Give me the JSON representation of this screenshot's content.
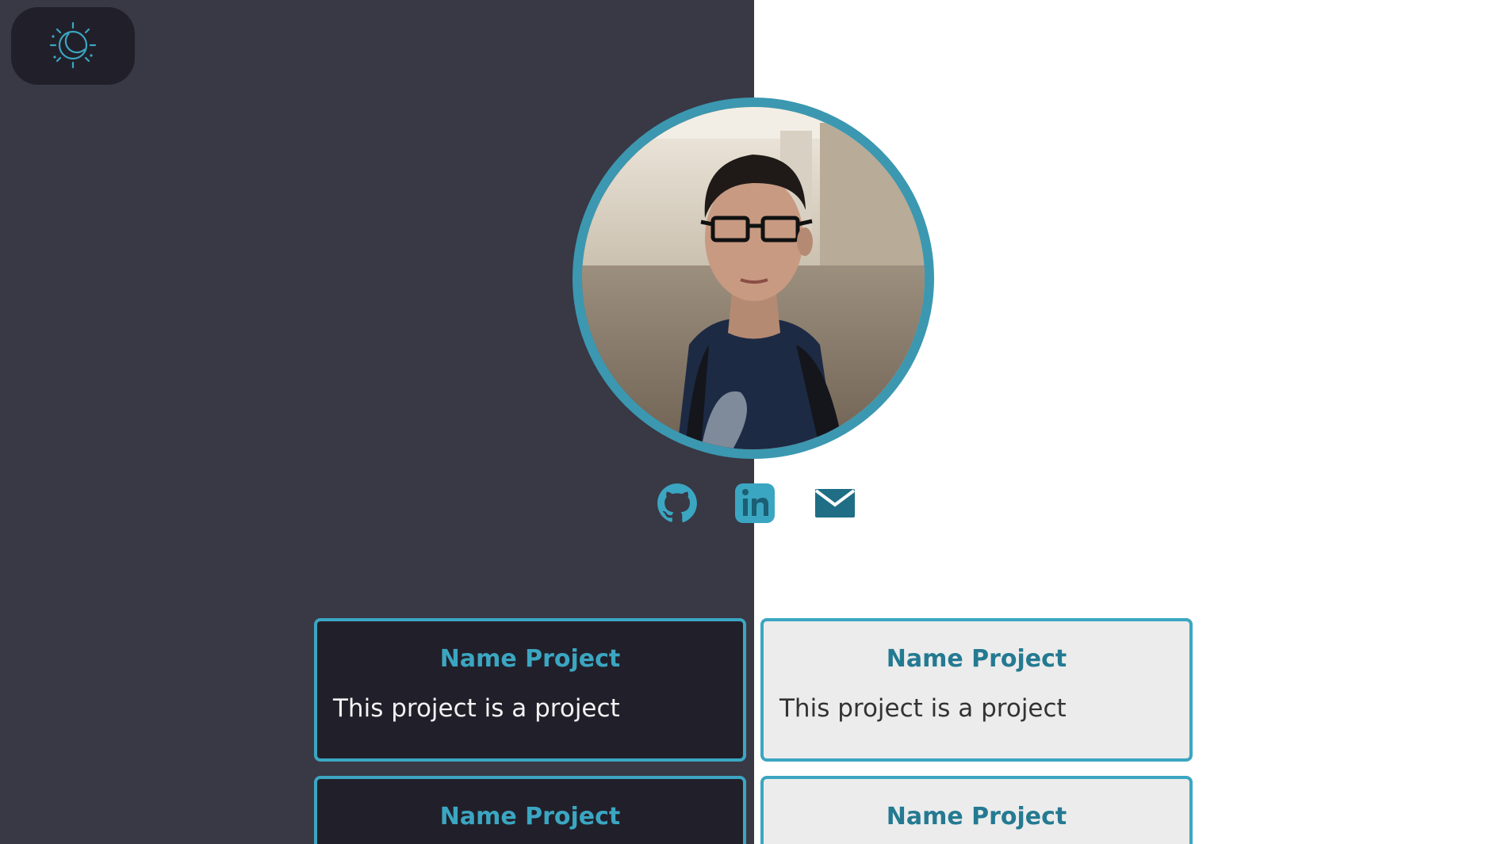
{
  "theme": {
    "dark_bg": "#393845",
    "light_bg": "#ffffff",
    "accent": "#3ba6c2",
    "toggle_icon": "sun-moon-icon"
  },
  "profile": {
    "avatar_alt": "profile photo"
  },
  "socials": [
    {
      "icon": "github-icon"
    },
    {
      "icon": "linkedin-icon"
    },
    {
      "icon": "mail-icon"
    }
  ],
  "projects": [
    {
      "title": "Name Project",
      "description": "This project is a project"
    },
    {
      "title": "Name Project",
      "description": "This project is a project"
    },
    {
      "title": "Name Project",
      "description": ""
    },
    {
      "title": "Name Project",
      "description": ""
    }
  ]
}
